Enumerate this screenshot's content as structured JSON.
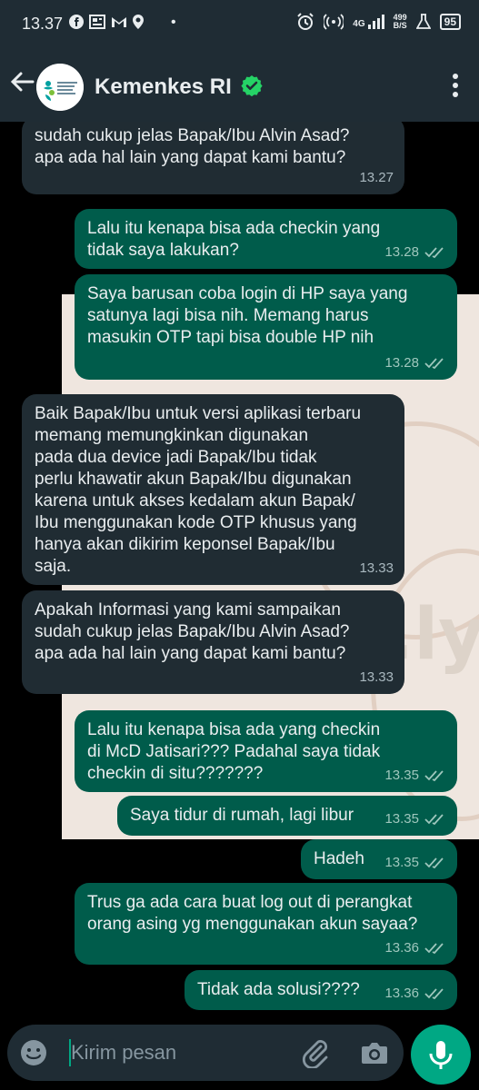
{
  "status_bar": {
    "time": "13.37",
    "net_speed_value": "499",
    "net_speed_unit": "B/S",
    "network": "4G",
    "battery": "95",
    "icons_left": [
      "facebook-icon",
      "news-icon",
      "gmail-icon",
      "location-icon"
    ],
    "icons_right": [
      "alarm-icon",
      "hotspot-icon",
      "signal-icon",
      "flask-icon",
      "battery-icon"
    ]
  },
  "header": {
    "contact_name": "Kemenkes RI",
    "avatar_text": "KEMENTERIAN KESEHATAN REPUBLIK INDONESIA",
    "verified": true
  },
  "messages": [
    {
      "dir": "in",
      "text": "sudah cukup jelas Bapak/Ibu Alvin Asad?\napa ada hal lain yang dapat kami bantu?",
      "time": "13.27"
    },
    {
      "dir": "out",
      "text": "Lalu itu kenapa bisa ada checkin yang\ntidak saya lakukan?",
      "time": "13.28"
    },
    {
      "dir": "out",
      "text": "Saya barusan coba login di HP saya yang\nsatunya lagi bisa nih. Memang harus\nmasukin OTP tapi bisa double HP nih",
      "time": "13.28"
    },
    {
      "dir": "in",
      "text": "Baik Bapak/Ibu untuk versi aplikasi terbaru\nmemang memungkinkan digunakan\npada dua device jadi Bapak/Ibu tidak\nperlu khawatir akun Bapak/Ibu digunakan\nkarena untuk akses kedalam akun Bapak/\nIbu menggunakan kode OTP khusus yang\nhanya akan dikirim keponsel Bapak/Ibu\nsaja.",
      "time": "13.33"
    },
    {
      "dir": "in",
      "text": "Apakah Informasi yang kami sampaikan\nsudah cukup jelas Bapak/Ibu Alvin Asad?\napa ada hal lain yang dapat kami bantu?",
      "time": "13.33"
    },
    {
      "dir": "out",
      "text": "Lalu itu kenapa bisa ada yang checkin\ndi McD Jatisari??? Padahal saya tidak\ncheckin di situ???????",
      "time": "13.35"
    },
    {
      "dir": "out",
      "text": "Saya tidur di rumah, lagi libur",
      "time": "13.35"
    },
    {
      "dir": "out",
      "text": "Hadeh",
      "time": "13.35"
    },
    {
      "dir": "out",
      "text": "Trus ga ada cara buat log out di perangkat\norang asing yg menggunakan akun sayaa?",
      "time": "13.36"
    },
    {
      "dir": "out",
      "text": "Tidak ada solusi????",
      "time": "13.36"
    }
  ],
  "wallpaper_text": "r.ly",
  "input": {
    "placeholder": "Kirim pesan"
  },
  "colors": {
    "incoming_bubble": "#202c33",
    "outgoing_bubble": "#005c4b",
    "accent": "#00a884",
    "verified": "#25d366"
  }
}
